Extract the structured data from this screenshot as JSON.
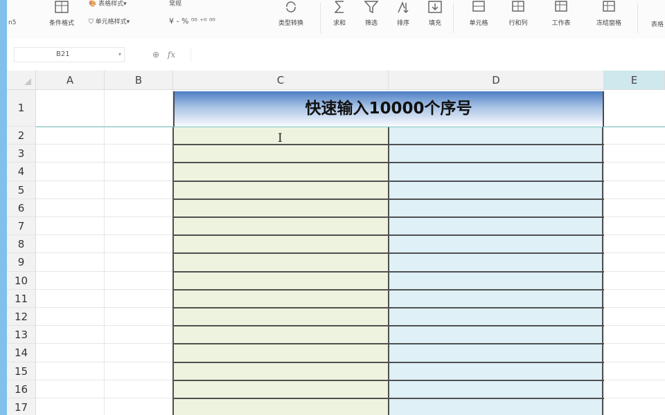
{
  "ribbon": {
    "items": [
      {
        "name": "conditional-format-button",
        "label": "条件格式"
      },
      {
        "name": "cell-style-button",
        "label": "单元格样式"
      },
      {
        "name": "table-style-button",
        "label": "表格样式"
      },
      {
        "name": "font-label",
        "label": "常规"
      },
      {
        "name": "type-convert-button",
        "label": "类型转换"
      },
      {
        "name": "sum-button",
        "label": "求和"
      },
      {
        "name": "filter-button",
        "label": "筛选"
      },
      {
        "name": "sort-button",
        "label": "排序"
      },
      {
        "name": "fill-button",
        "label": "填充"
      },
      {
        "name": "cells-button",
        "label": "单元格"
      },
      {
        "name": "row-col-button",
        "label": "行和列"
      },
      {
        "name": "worksheet-button",
        "label": "工作表"
      },
      {
        "name": "freeze-pane-button",
        "label": "冻结窗格"
      }
    ],
    "num_format_symbols": "¥ - % ⁰⁰ ⁺⁰ ⁰⁰",
    "left_label": "n5",
    "far_right": "表格"
  },
  "formula_bar": {
    "name_box": "B21",
    "fx_symbol": "fx"
  },
  "columns": [
    "A",
    "B",
    "C",
    "D",
    "E"
  ],
  "rows": [
    "1",
    "2",
    "3",
    "4",
    "5",
    "6",
    "7",
    "8",
    "9",
    "10",
    "11",
    "12",
    "13",
    "14",
    "15",
    "16",
    "17"
  ],
  "title_cell": "快速输入10000个序号",
  "colors": {
    "title_top": "#4d7fc4",
    "col_c_fill": "#eef3df",
    "col_d_fill": "#dff0f7",
    "selected_header": "#cfe8ee"
  }
}
